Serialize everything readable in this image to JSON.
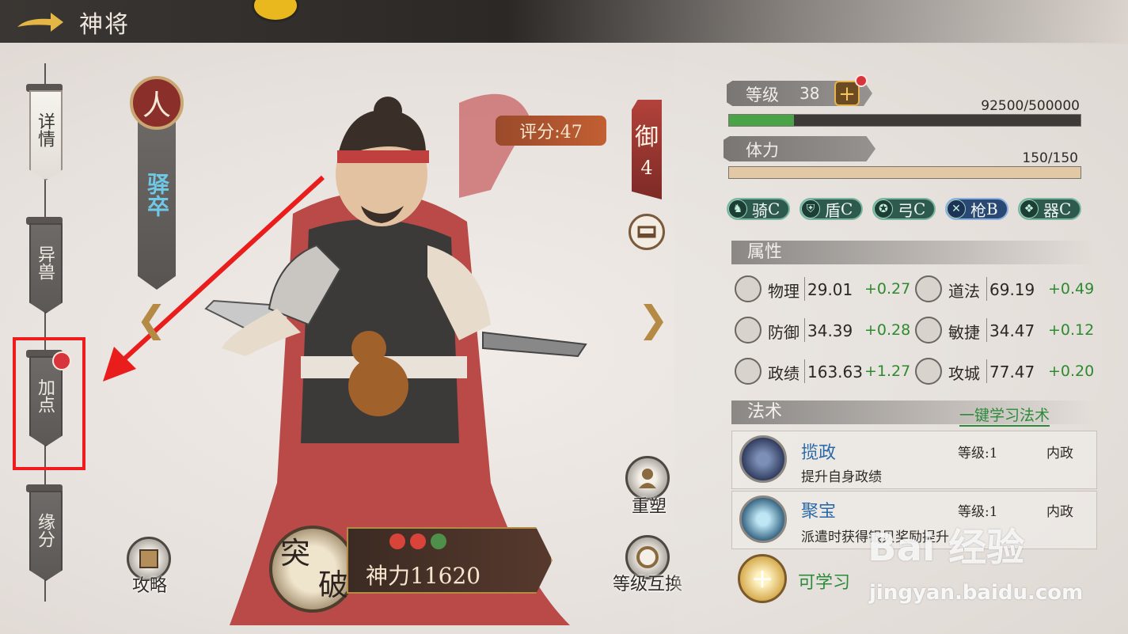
{
  "header": {
    "title": "神将"
  },
  "tabs": [
    {
      "label": "详情",
      "active": true
    },
    {
      "label": "异兽",
      "active": false
    },
    {
      "label": "加点",
      "active": false,
      "has_notification": true
    },
    {
      "label": "缘分",
      "active": false
    }
  ],
  "hero": {
    "class_emblem": "人",
    "class_name": "驿卒",
    "score_text": "评分:47",
    "defense_label": "御",
    "defense_value": "4"
  },
  "bottom_actions": {
    "guide_label": "攻略",
    "breakthrough_char1": "突",
    "breakthrough_char2": "破",
    "power_label": "神力11620",
    "reshape_label": "重塑",
    "level_swap_label": "等级互换",
    "flames": [
      "#d9443a",
      "#d9443a",
      "#4e8f4a"
    ]
  },
  "stats": {
    "level_label": "等级",
    "level_value": "38",
    "exp_text": "92500/500000",
    "exp_progress": 0.185,
    "stamina_label": "体力",
    "stamina_text": "150/150",
    "stamina_progress": 1.0
  },
  "troops": [
    {
      "char": "骑",
      "grade": "C",
      "icon": "horse-icon",
      "style": "green"
    },
    {
      "char": "盾",
      "grade": "C",
      "icon": "shield-icon",
      "style": "green"
    },
    {
      "char": "弓",
      "grade": "C",
      "icon": "bow-icon",
      "style": "green"
    },
    {
      "char": "枪",
      "grade": "B",
      "icon": "spear-icon",
      "style": "blue"
    },
    {
      "char": "器",
      "grade": "C",
      "icon": "siege-icon",
      "style": "green"
    }
  ],
  "attributes": {
    "title": "属性",
    "items": [
      {
        "name": "物理",
        "value": "29.01",
        "inc": "+0.27",
        "icon": "sword-icon"
      },
      {
        "name": "道法",
        "value": "69.19",
        "inc": "+0.49",
        "icon": "taoism-icon"
      },
      {
        "name": "防御",
        "value": "34.39",
        "inc": "+0.28",
        "icon": "helmet-icon"
      },
      {
        "name": "敏捷",
        "value": "34.47",
        "inc": "+0.12",
        "icon": "boot-icon"
      },
      {
        "name": "政绩",
        "value": "163.63",
        "inc": "+1.27",
        "icon": "governance-icon"
      },
      {
        "name": "攻城",
        "value": "77.47",
        "inc": "+0.20",
        "icon": "castle-icon"
      }
    ]
  },
  "spells": {
    "title": "法术",
    "learn_all_label": "一键学习法术",
    "items": [
      {
        "name": "揽政",
        "desc": "提升自身政绩",
        "level": "等级:1",
        "type": "内政"
      },
      {
        "name": "聚宝",
        "desc": "派遣时获得银贝奖励提升",
        "level": "等级:1",
        "type": "内政"
      }
    ],
    "learnable_label": "可学习"
  },
  "watermark": {
    "brand": "Bai 经验",
    "url": "jingyan.baidu.com"
  }
}
